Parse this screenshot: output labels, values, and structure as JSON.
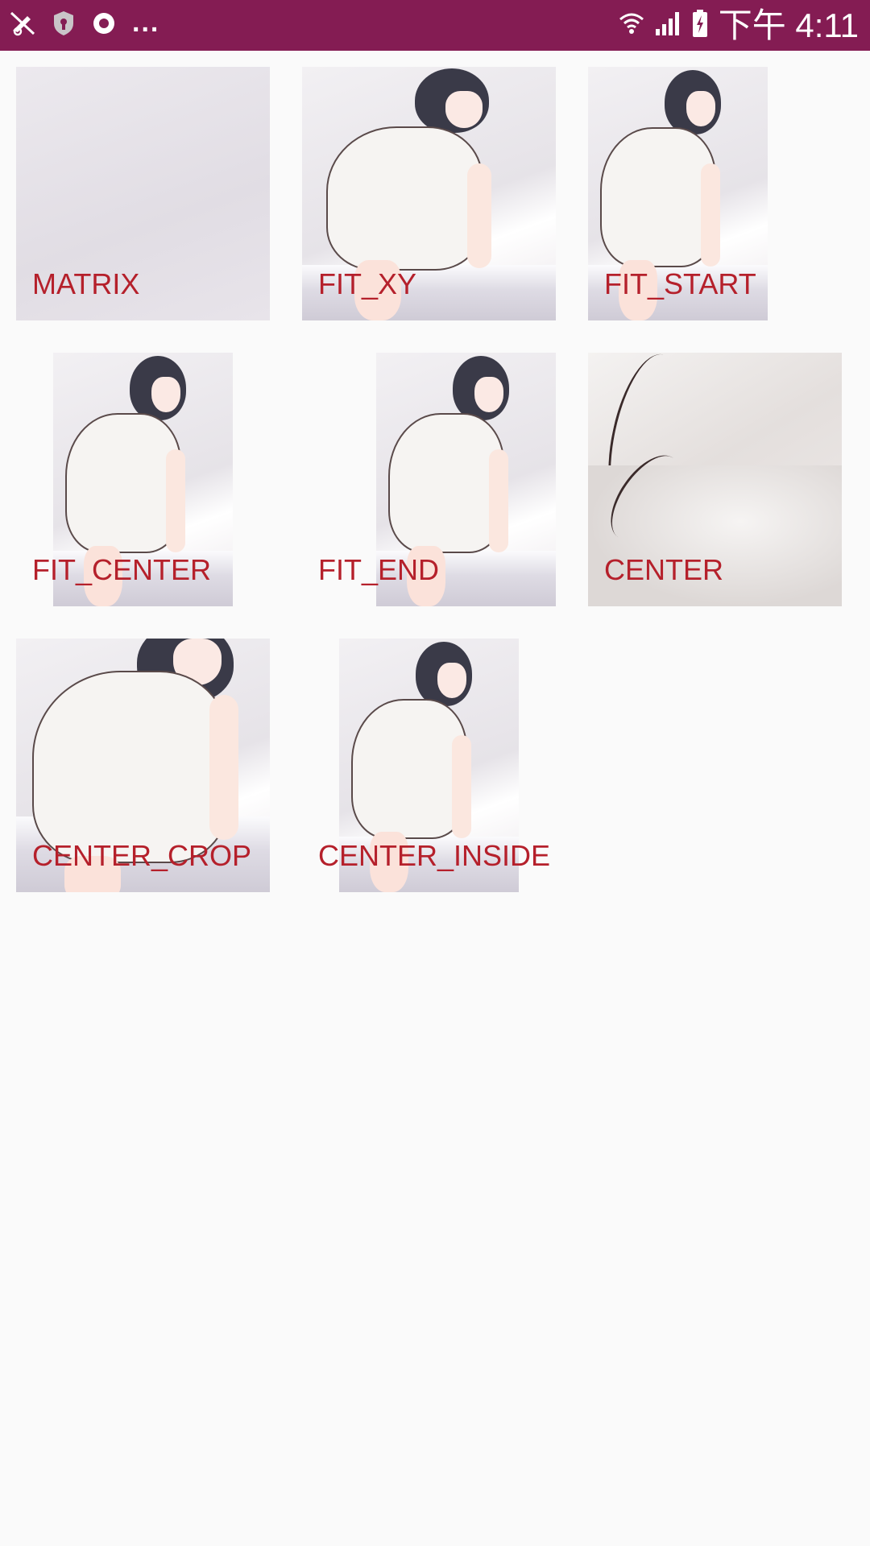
{
  "status_bar": {
    "background": "#841c53",
    "left_icons": [
      "muted-notification-icon",
      "shield-icon",
      "record-circle-icon"
    ],
    "overflow": "...",
    "right_icons": [
      "wifi-icon",
      "cell-signal-icon",
      "battery-charging-icon"
    ],
    "time": "下午 4:11"
  },
  "grid": {
    "label_color": "#b5202b",
    "tiles": [
      {
        "label": "MATRIX"
      },
      {
        "label": "FIT_XY"
      },
      {
        "label": "FIT_START"
      },
      {
        "label": "FIT_CENTER"
      },
      {
        "label": "FIT_END"
      },
      {
        "label": "CENTER"
      },
      {
        "label": "CENTER_CROP"
      },
      {
        "label": "CENTER_INSIDE"
      }
    ]
  }
}
